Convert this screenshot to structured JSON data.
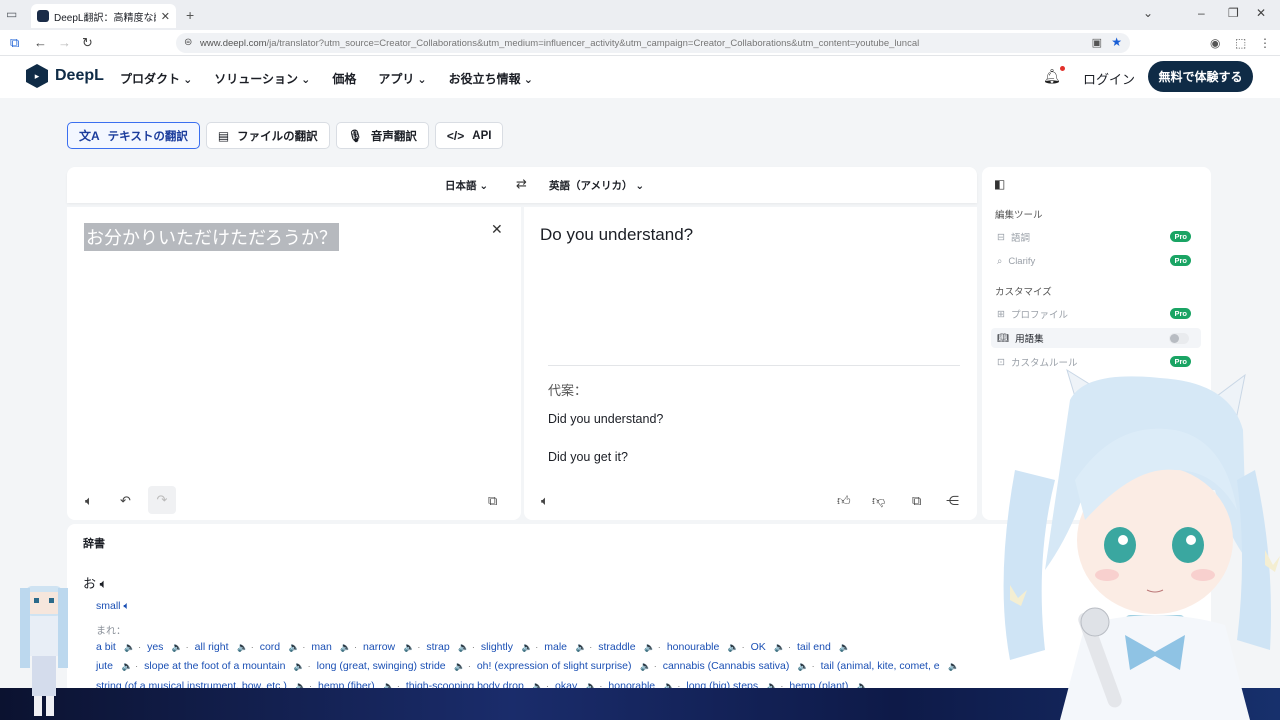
{
  "browser": {
    "tab_title": "DeepL翻訳：高精度な翻訳ツール",
    "tab_close": "✕",
    "new_tab": "+",
    "url_domain": "www.deepl.com",
    "url_path": "/ja/translator?utm_source=Creator_Collaborations&utm_medium=influencer_activity&utm_campaign=Creator_Collaborations&utm_content=youtube_luncal"
  },
  "header": {
    "logo_text": "DeepL",
    "nav": [
      "プロダクト",
      "ソリューション",
      "価格",
      "アプリ",
      "お役立ち情報"
    ],
    "login": "ログイン",
    "cta": "無料で体験する"
  },
  "modes": {
    "text": "テキストの翻訳",
    "file": "ファイルの翻訳",
    "voice": "音声翻訳",
    "api": "API"
  },
  "translator": {
    "source_lang": "日本語",
    "target_lang": "英語（アメリカ）",
    "source_text": "お分かりいただけただろうか？",
    "target_text": "Do you understand?",
    "alternatives_label": "代案：",
    "alternatives": [
      "Did you understand?",
      "Did you get it?"
    ]
  },
  "sidebar": {
    "edit_tools_heading": "編集ツール",
    "items_edit": [
      {
        "label": "語調",
        "badge": "Pro"
      },
      {
        "label": "Clarify",
        "badge": "Pro"
      }
    ],
    "customize_heading": "カスタマイズ",
    "items_custom": [
      {
        "label": "プロファイル",
        "badge": "Pro"
      },
      {
        "label": "用語集",
        "badge": ""
      },
      {
        "label": "カスタムルール",
        "badge": "Pro"
      }
    ]
  },
  "dictionary": {
    "title": "辞書",
    "word": "お",
    "sense": "small",
    "rare_label": "まれ：",
    "row1": [
      "a bit",
      "yes",
      "all right",
      "cord",
      "man",
      "narrow",
      "strap",
      "slightly",
      "male",
      "straddle",
      "honourable",
      "OK",
      "tail end"
    ],
    "row2": [
      "jute",
      "slope at the foot of a mountain",
      "long (great, swinging) stride",
      "oh! (expression of slight surprise)",
      "cannabis (Cannabis sativa)",
      "tail (animal, kite, comet, e"
    ],
    "row3": [
      "string (of a musical instrument, bow, etc.)",
      "hemp (fiber)",
      "thigh-scooping body drop",
      "okay",
      "honorable",
      "long (big) steps",
      "hemp (plant)"
    ]
  },
  "colors": {
    "brand": "#0f2b46",
    "pro_badge": "#1aa464",
    "link": "#1a4fb4"
  }
}
